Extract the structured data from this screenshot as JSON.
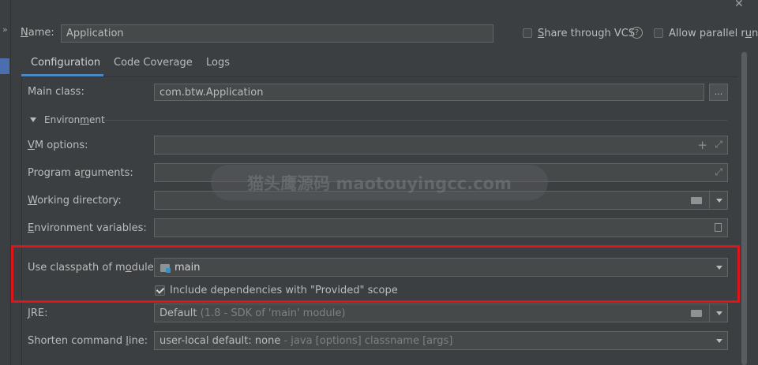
{
  "window": {
    "close_glyph": "✕",
    "left_more_glyph": "»"
  },
  "header": {
    "name_prefix": "N",
    "name_rest": "ame:",
    "name_value": "Application",
    "share_prefix": "S",
    "share_rest": "hare through VCS",
    "help_glyph": "?",
    "parallel_pre": "Allow parallel r",
    "parallel_u": "u",
    "parallel_post": "n"
  },
  "tabs": [
    {
      "label": "Configuration",
      "active": true
    },
    {
      "label": "Code Coverage",
      "active": false
    },
    {
      "label": "Logs",
      "active": false
    }
  ],
  "form": {
    "main_class_label": "Main class:",
    "main_class_value": "com.btw.Application",
    "browse_label": "...",
    "environment_pre": "Environ",
    "environment_u": "m",
    "environment_post": "ent",
    "vm_u": "V",
    "vm_rest": "M options:",
    "prog_pre": "Program a",
    "prog_u": "r",
    "prog_post": "guments:",
    "wd_u": "W",
    "wd_rest": "orking directory:",
    "env_u": "E",
    "env_rest": "nvironment variables:",
    "module_pre": "Use classpath of m",
    "module_u": "o",
    "module_post": "dule:",
    "module_value": "main",
    "include_label": "Include dependencies with \"Provided\" scope",
    "include_checked": true,
    "jre_u": "J",
    "jre_rest": "RE:",
    "jre_value": "Default",
    "jre_hint": "(1.8 - SDK of 'main' module)",
    "shorten_pre": "Shorten command ",
    "shorten_u": "l",
    "shorten_post": "ine:",
    "shorten_value": "user-local default: none",
    "shorten_hint": "- java [options] classname [args]"
  },
  "watermark": {
    "text": "猫头鹰源码 maotouyingcc.com"
  },
  "colors": {
    "background": "#3c3f41",
    "field": "#45494a",
    "tab_underline": "#4a88c7",
    "highlight_box": "#e0141b"
  }
}
